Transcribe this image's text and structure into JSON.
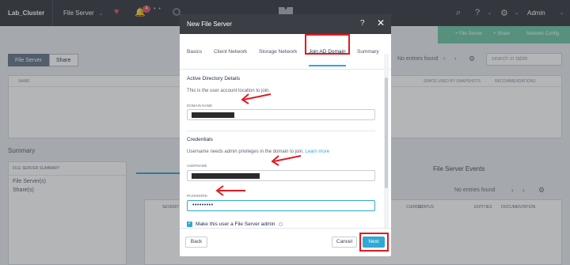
{
  "topbar": {
    "cluster_name": "Lab_Cluster",
    "menu_label": "File Server",
    "alert_count": "4",
    "admin_label": "Admin"
  },
  "green_actions": [
    "+ File Server",
    "+ Share",
    "Network Config"
  ],
  "content": {
    "tabs": [
      "File Server",
      "Share"
    ],
    "entries_text": "No entries found",
    "search_placeholder": "search in table",
    "table_headers": [
      "Name",
      "Space used by snapshots",
      "Recommendations"
    ],
    "summary_title": "Summary",
    "summary_header": "File server summary",
    "summary_rows": [
      "File Server(s)",
      "Share(s)"
    ],
    "events_title": "File Server Events",
    "events_entries_text": "No entries found",
    "events_headers": [
      "Severit",
      "curred",
      "Status",
      "Entities",
      "Documentation"
    ]
  },
  "modal": {
    "title": "New File Server",
    "help_icon": "?",
    "close_icon": "✕",
    "steps": [
      "Basics",
      "Client Network",
      "Storage Network",
      "Join AD Domain",
      "Summary"
    ],
    "active_step": "Join AD Domain",
    "section_ad": "Active Directory Details",
    "ad_desc": "This is the user account location to join.",
    "domain_label": "DOMAIN NAME",
    "section_cred": "Credentials",
    "cred_desc": "Username needs admin privileges in the domain to join.",
    "learn_more": "Learn more",
    "username_label": "USERNAME",
    "password_label": "PASSWORD",
    "password_value": "•••••••••",
    "admin_checkbox_label": "Make this user a File Server admin",
    "back_label": "Back",
    "cancel_label": "Cancel",
    "next_label": "Next"
  },
  "colors": {
    "topbar": "#3b3f45",
    "accent": "#2fa9d6",
    "green": "#71c8a7",
    "annotation_red": "#e11b22"
  }
}
